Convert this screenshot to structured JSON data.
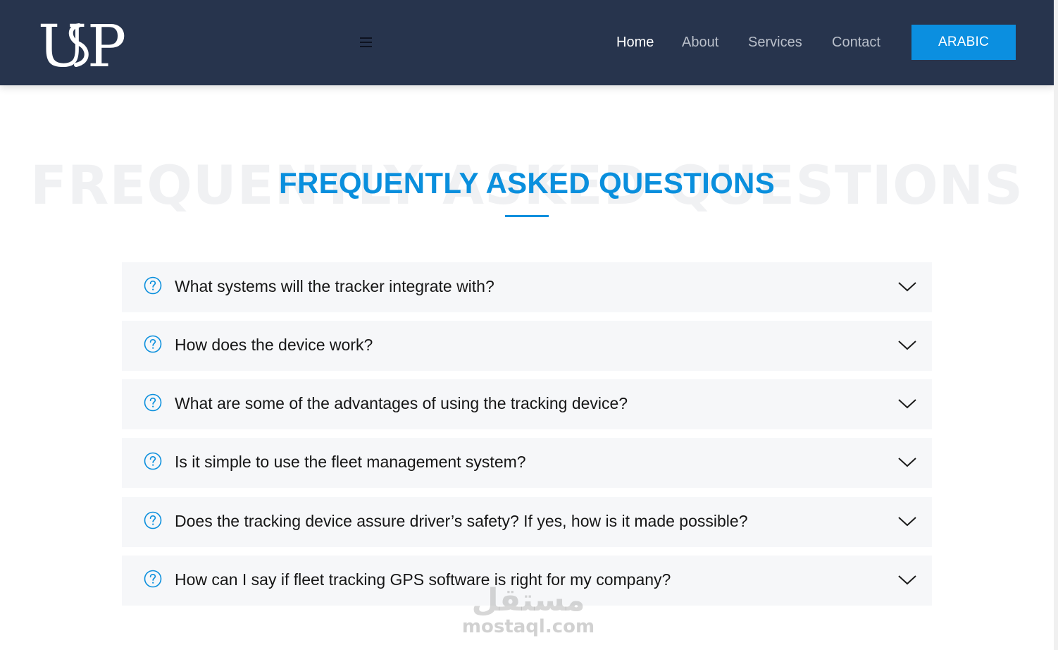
{
  "header": {
    "logo_text": "USP",
    "menu_icon": "hamburger-icon",
    "nav": [
      {
        "label": "Home",
        "active": true
      },
      {
        "label": "About",
        "active": false
      },
      {
        "label": "Services",
        "active": false
      },
      {
        "label": "Contact",
        "active": false
      }
    ],
    "language_button": "ARABIC",
    "colors": {
      "background": "#27344d",
      "accent": "#0b8fe0"
    }
  },
  "faq": {
    "background_title": "FREQUENTLY ASKED QUESTIONS",
    "title": "FREQUENTLY ASKED QUESTIONS",
    "item_icon": "question-circle-icon",
    "toggle_icon": "chevron-down-icon",
    "items": [
      {
        "question": "What systems will the tracker integrate with?",
        "expanded": false
      },
      {
        "question": "How does the device work?",
        "expanded": false
      },
      {
        "question": "What are some of the advantages of using the tracking device?",
        "expanded": false
      },
      {
        "question": "Is it simple to use the fleet management system?",
        "expanded": false
      },
      {
        "question": "Does the tracking device assure driver’s safety? If yes, how is it made possible?",
        "expanded": false
      },
      {
        "question": "How can I say if fleet tracking GPS software is right for my company?",
        "expanded": false
      }
    ],
    "colors": {
      "title": "#0a8fdd",
      "item_background": "#f6f7f9"
    }
  },
  "watermark": {
    "arabic": "مستقل",
    "domain": "mostaql.com"
  }
}
